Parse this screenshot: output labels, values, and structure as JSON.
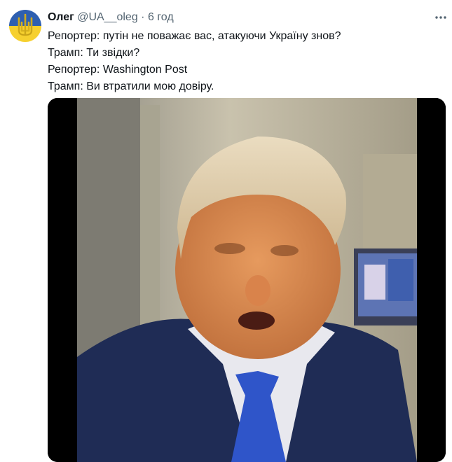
{
  "tweet": {
    "author_name": "Олег",
    "author_handle": "@UA__oleg",
    "separator": "·",
    "time": "6 год",
    "lines": [
      "Репортер: путін не поважає вас, атакуючи Україну знов?",
      "Трамп: Ти звідки?",
      "Репортер: Washington Post",
      "Трамп: Ви втратили мою довіру."
    ]
  },
  "icons": {
    "avatar": "trident-emblem-icon",
    "more": "more-horizontal-icon"
  },
  "colors": {
    "text_primary": "#0f1419",
    "text_secondary": "#536471",
    "avatar_blue": "#2e5fb0",
    "avatar_yellow": "#f6d02f",
    "media_frame": "#000000"
  }
}
